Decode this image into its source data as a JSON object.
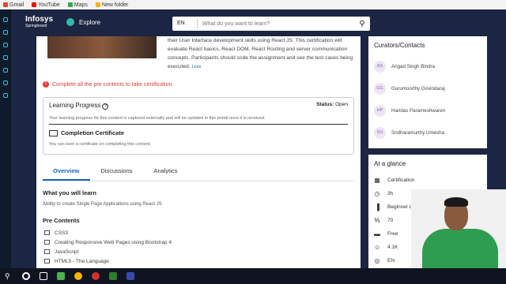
{
  "bookmarks": [
    "Gmail",
    "YouTube",
    "Maps",
    "New folder"
  ],
  "nav": {
    "logo": "Infosys",
    "logo_sub": "Springboard",
    "explore": "Explore",
    "lang": "EN",
    "search_placeholder": "What do you want to learn?"
  },
  "description": {
    "text": "their User Interface development skills using React JS. This certification will evaluate React basics, React DOM, React Routing and server communication concepts. Participants should code the assignment and see the test cases being executed.",
    "less": "Less"
  },
  "warning": "Complete all the pre contents to take certification.",
  "progress": {
    "title": "Learning Progress",
    "status_label": "Status:",
    "status_value": "Open",
    "note": "Your learning progress for this content is captured externally and will be updated in this portal once it is received.",
    "cert_title": "Completion Certificate",
    "cert_note": "You can earn a certificate on completing this content."
  },
  "tabs": [
    "Overview",
    "Discussions",
    "Analytics"
  ],
  "learn": {
    "title": "What you will learn",
    "text": "Ability to create Single Page Applications using React JS"
  },
  "pre": {
    "title": "Pre Contents",
    "items": [
      "CSS3",
      "Creating Responsive Web Pages using Bootstrap 4",
      "JavaScript",
      "HTML5 - The Language"
    ]
  },
  "curators": {
    "title": "Curators/Contacts",
    "people": [
      {
        "initials": "AS",
        "name": "Angad Singh Bindra"
      },
      {
        "initials": "GG",
        "name": "Gurumoorthy Govindaraj"
      },
      {
        "initials": "HP",
        "name": "Haridas Parameshwaren"
      },
      {
        "initials": "SU",
        "name": "Sridharamurthy Umesha"
      }
    ]
  },
  "glance": {
    "title": "At a glance",
    "rows": [
      {
        "icon": "grid-icon",
        "label": "Certification"
      },
      {
        "icon": "clock-icon",
        "label": "3h"
      },
      {
        "icon": "level-icon",
        "label": "Beginner Level"
      },
      {
        "icon": "percent-icon",
        "label": "70"
      },
      {
        "icon": "wallet-icon",
        "label": "Free"
      },
      {
        "icon": "people-icon",
        "label": "4.1K"
      },
      {
        "icon": "globe-icon",
        "label": "EN"
      }
    ]
  },
  "colors": {
    "nav_bg": "#1c2541",
    "accent": "#1565c0",
    "warn": "#e53935"
  }
}
